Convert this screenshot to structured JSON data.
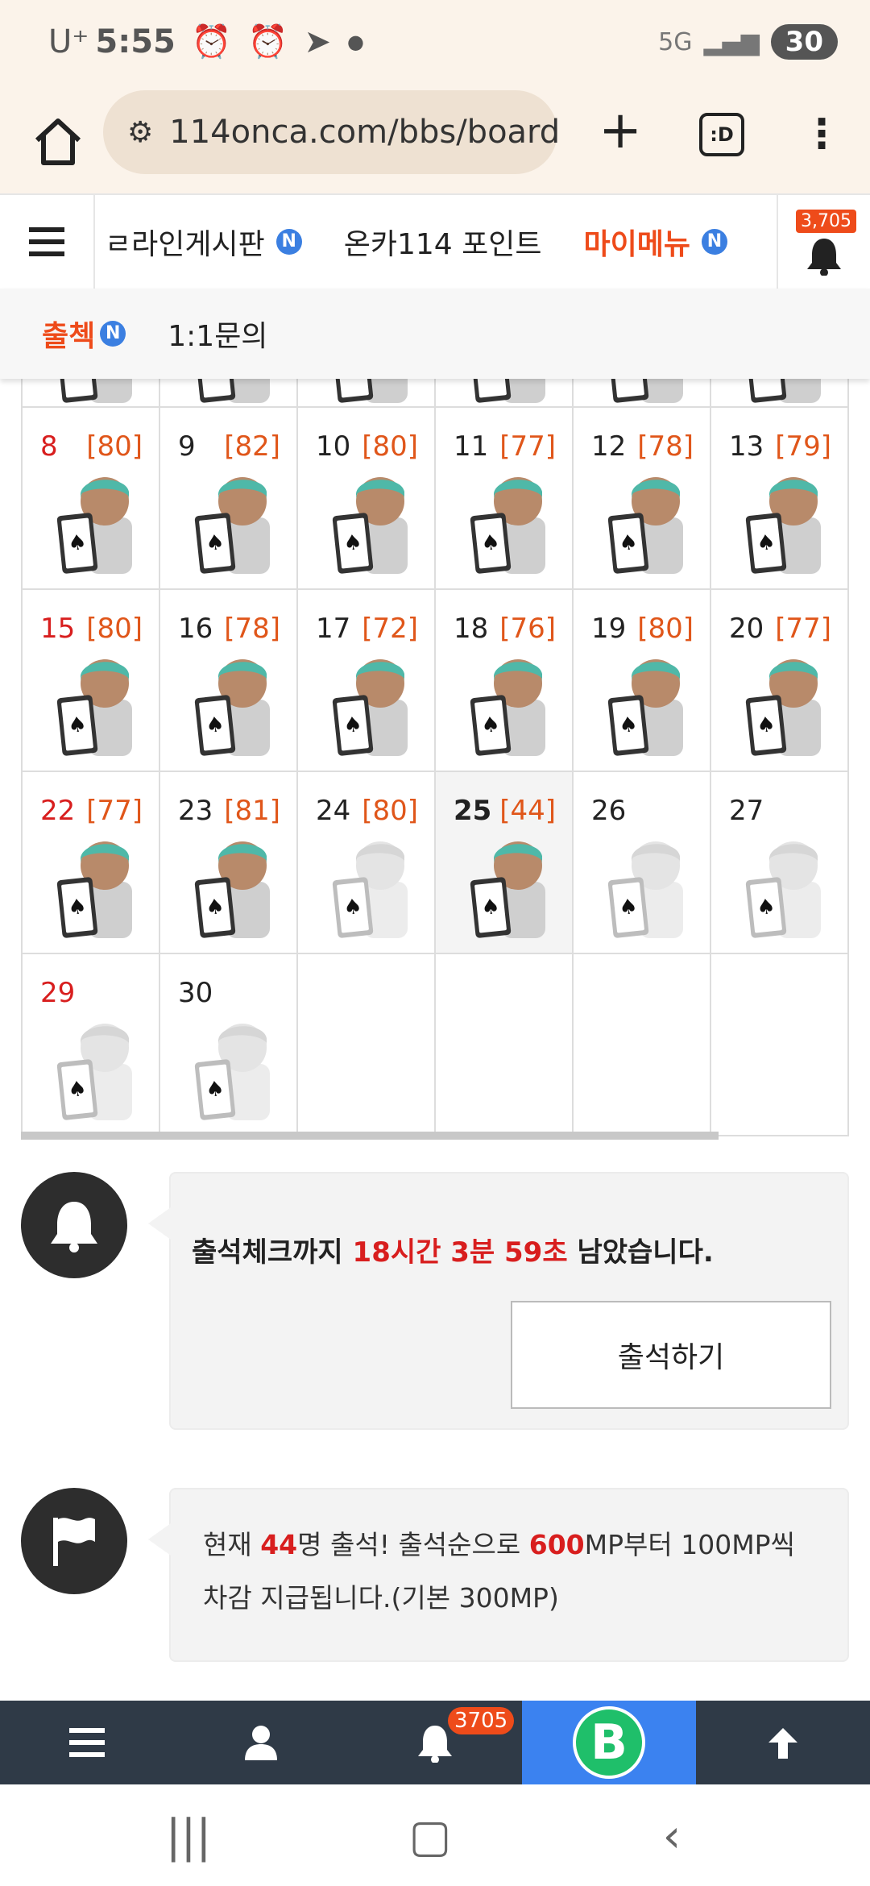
{
  "status_bar": {
    "carrier": "U⁺",
    "time": "5:55",
    "network": "5G",
    "battery": "30"
  },
  "browser": {
    "url": "114onca.com/bbs/board.",
    "tab_count": ":D"
  },
  "nav": {
    "items": [
      {
        "label": "ㄹ라인게시판",
        "badge": "N"
      },
      {
        "label": "온카114 포인트",
        "badge": ""
      },
      {
        "label": "마이메뉴",
        "badge": "N"
      }
    ],
    "bell_count": "3,705"
  },
  "subnav": {
    "items": [
      {
        "label": "출첵",
        "badge": "N"
      },
      {
        "label": "1:1문의",
        "badge": ""
      }
    ]
  },
  "calendar": {
    "weeks": [
      [
        {
          "day": "8",
          "score": "[80]",
          "holiday": true,
          "attended": true
        },
        {
          "day": "9",
          "score": "[82]",
          "holiday": false,
          "attended": true
        },
        {
          "day": "10",
          "score": "[80]",
          "holiday": false,
          "attended": true
        },
        {
          "day": "11",
          "score": "[77]",
          "holiday": false,
          "attended": true
        },
        {
          "day": "12",
          "score": "[78]",
          "holiday": false,
          "attended": true
        },
        {
          "day": "13",
          "score": "[79]",
          "holiday": false,
          "attended": true
        }
      ],
      [
        {
          "day": "15",
          "score": "[80]",
          "holiday": true,
          "attended": true
        },
        {
          "day": "16",
          "score": "[78]",
          "holiday": false,
          "attended": true
        },
        {
          "day": "17",
          "score": "[72]",
          "holiday": false,
          "attended": true
        },
        {
          "day": "18",
          "score": "[76]",
          "holiday": false,
          "attended": true
        },
        {
          "day": "19",
          "score": "[80]",
          "holiday": false,
          "attended": true
        },
        {
          "day": "20",
          "score": "[77]",
          "holiday": false,
          "attended": true
        }
      ],
      [
        {
          "day": "22",
          "score": "[77]",
          "holiday": true,
          "attended": true
        },
        {
          "day": "23",
          "score": "[81]",
          "holiday": false,
          "attended": true
        },
        {
          "day": "24",
          "score": "[80]",
          "holiday": false,
          "attended": false
        },
        {
          "day": "25",
          "score": "[44]",
          "holiday": false,
          "attended": true,
          "today": true
        },
        {
          "day": "26",
          "score": "",
          "holiday": false,
          "attended": false
        },
        {
          "day": "27",
          "score": "",
          "holiday": false,
          "attended": false
        }
      ],
      [
        {
          "day": "29",
          "score": "",
          "holiday": true,
          "attended": false
        },
        {
          "day": "30",
          "score": "",
          "holiday": false,
          "attended": false
        },
        {
          "day": "",
          "score": "",
          "holiday": false,
          "attended": null
        },
        {
          "day": "",
          "score": "",
          "holiday": false,
          "attended": null
        },
        {
          "day": "",
          "score": "",
          "holiday": false,
          "attended": null
        },
        {
          "day": "",
          "score": "",
          "holiday": false,
          "attended": null
        }
      ]
    ]
  },
  "countdown": {
    "prefix": "출석체크까지 ",
    "time": "18시간 3분 59초",
    "suffix": " 남았습니다.",
    "button": "출석하기"
  },
  "info": {
    "p1": "현재 ",
    "count": "44",
    "p2": "명 출석! 출석순으로 ",
    "mp": "600",
    "p3": "MP부터 100MP씩 차감 지급됩니다.(기본 300MP)"
  },
  "bottom_bar": {
    "bell_count": "3705",
    "brand_letter": "B"
  }
}
